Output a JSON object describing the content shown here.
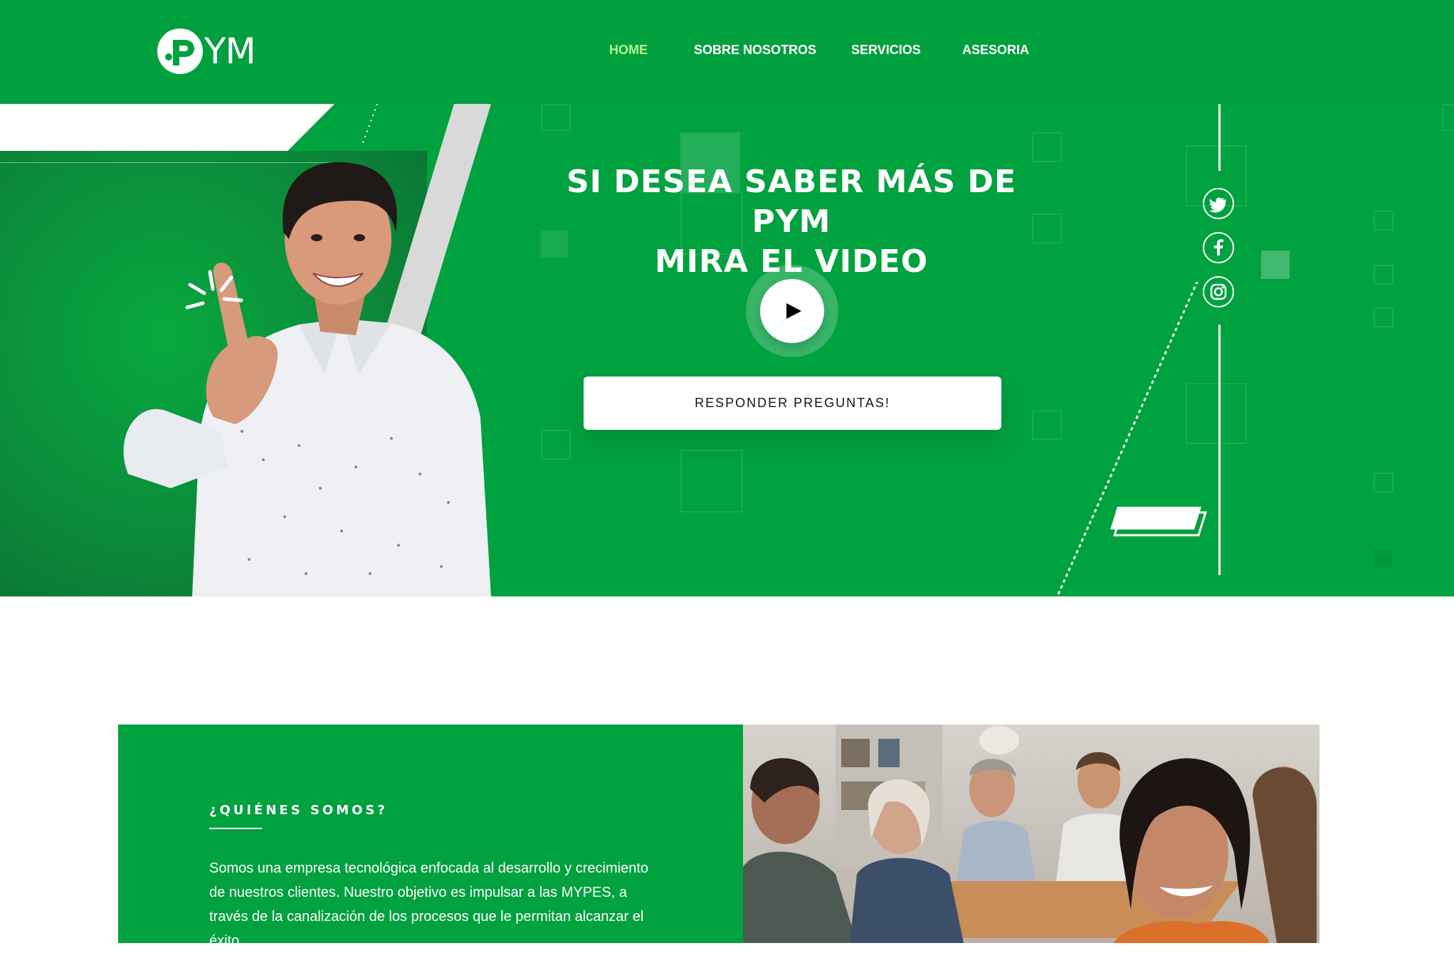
{
  "header": {
    "logo_text": "YM",
    "nav": [
      {
        "label": "HOME",
        "active": true
      },
      {
        "label": "SOBRE NOSOTROS",
        "active": false
      },
      {
        "label": "SERVICIOS",
        "active": false
      },
      {
        "label": "ASESORIA",
        "active": false
      }
    ]
  },
  "hero": {
    "title_line1": "SI DESEA SABER MÁS DE PYM",
    "title_line2": "MIRA EL VIDEO",
    "play_icon": "play-icon",
    "cta_label": "RESPONDER PREGUNTAS!",
    "social": [
      {
        "icon": "twitter-icon"
      },
      {
        "icon": "facebook-icon"
      },
      {
        "icon": "instagram-icon"
      }
    ]
  },
  "about": {
    "heading": "¿QUIÉNES SOMOS?",
    "text": "Somos una empresa tecnológica enfocada al desarrollo y crecimiento de nuestros clientes. Nuestro objetivo es impulsar a las MYPES, a través de la canalización de los procesos que le permitan alcanzar el éxito."
  },
  "colors": {
    "brand_green": "#00a13f",
    "active_nav": "#b6f28b",
    "white": "#ffffff"
  }
}
